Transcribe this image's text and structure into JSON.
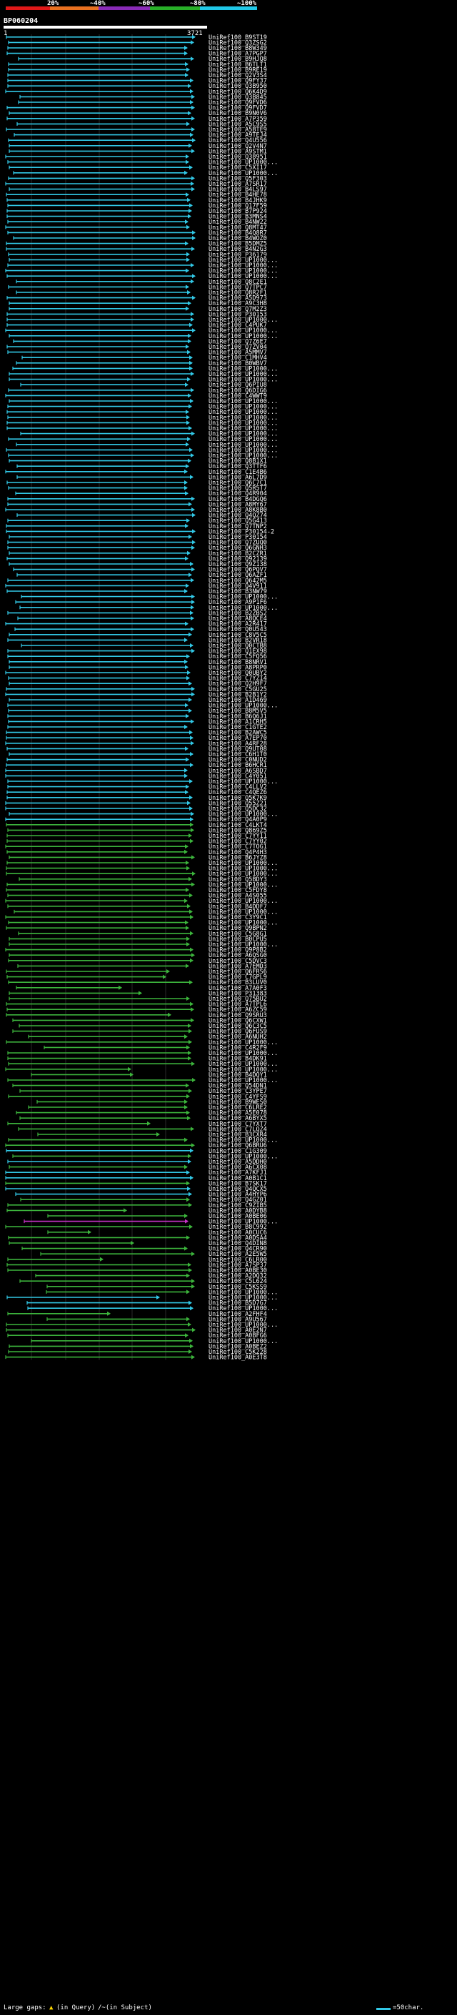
{
  "scale": {
    "labels": [
      "20%",
      "~40%",
      "~60%",
      "~80%",
      "~100%"
    ],
    "colors": [
      "#e01818",
      "#e87020",
      "#8a2bb8",
      "#28b028",
      "#20c8e8"
    ]
  },
  "query": {
    "name": "BP060204",
    "start": "1",
    "end": "3721"
  },
  "footer": {
    "gaps_label": "Large gaps:",
    "gap_query": "(in Query)",
    "gap_subject": "/~(in Subject)",
    "legend": "=50char."
  },
  "colors": {
    "cyan": "#32c8e6",
    "green": "#3cb43c",
    "magenta": "#c832c8",
    "grid": "#c8c8c8",
    "background": "#000000"
  },
  "hits": [
    "UniRef100_B9ST19",
    "UniRef100_Q3ZSG2",
    "UniRef100_B8W349",
    "UniRef100_A7PGP7",
    "UniRef100_B9HJQ8",
    "UniRef100_B6TLT1",
    "UniRef100_B9RE19",
    "UniRef100_Q2V3S4",
    "UniRef100_Q9FY37",
    "UniRef100_Q3B950",
    "UniRef100_Q6K4D9",
    "UniRef100_Q3B845",
    "UniRef100_Q9FVD6",
    "UniRef100_Q9FVD7",
    "UniRef100_B9N0V6",
    "UniRef100_A7P359",
    "UniRef100_A5C9S5",
    "UniRef100_A5BTE9",
    "UniRef100_A9TEJ4",
    "UniRef100_Q4U556",
    "UniRef100_Q2V4N7",
    "UniRef100_A9STM1",
    "UniRef100_Q38951",
    "UniRef100_UP1000...",
    "UniRef100_C5XI17",
    "UniRef100_UP1000...",
    "UniRef100_Q5F303",
    "UniRef100_A7SR17",
    "UniRef100_B4LS97",
    "UniRef100_B4HE78",
    "UniRef100_B4JHK9",
    "UniRef100_Q17F59",
    "UniRef100_B7P924",
    "UniRef100_B3MNS4",
    "UniRef100_B4NW22",
    "UniRef100_Q8MT47",
    "UniRef100_B4Q8R7",
    "UniRef100_B4WOZ0",
    "UniRef100_B5DMZ5",
    "UniRef100_B4N2G3",
    "UniRef100_P36179",
    "UniRef100_UP1000...",
    "UniRef100_UP1000...",
    "UniRef100_UP1000...",
    "UniRef100_UP1000...",
    "UniRef100_Q8C2E1",
    "UniRef100_Q7TPC7",
    "UniRef100_Q8R2F1",
    "UniRef100_A5D973",
    "UniRef100_A9C3H8",
    "UniRef100_Q7M2Z3",
    "UniRef100_P30153",
    "UniRef100_UP1000...",
    "UniRef100_C4PUK7",
    "UniRef100_UP1000...",
    "UniRef100_UP1000...",
    "UniRef100_Q7Z6E7",
    "UniRef100_Q7ZV04",
    "UniRef100_A5MMV7",
    "UniRef100_C1MHV4",
    "UniRef100_B0WBV7",
    "UniRef100_UP1000...",
    "UniRef100_UP1000...",
    "UniRef100_UP1000...",
    "UniRef100_Q6PIU8",
    "UniRef100_Q6DIG6",
    "UniRef100_C4WWT9",
    "UniRef100_UP1000...",
    "UniRef100_UP1000...",
    "UniRef100_UP1000...",
    "UniRef100_UP1000...",
    "UniRef100_UP1000...",
    "UniRef100_UP1000...",
    "UniRef100_UP1000...",
    "UniRef100_UP1000...",
    "UniRef100_UP1000...",
    "UniRef100_UP1000...",
    "UniRef100_UP1000...",
    "UniRef100_Q8B1X1",
    "UniRef100_Q3TTF6",
    "UniRef100_C1E4B6",
    "UniRef100_A6L7D9",
    "UniRef100_Q6C7C1",
    "UniRef100_Q5R5T7",
    "UniRef100_Q4R904",
    "UniRef100_B4DGQ6",
    "UniRef100_A8MY67",
    "UniRef100_A8K8B0",
    "UniRef100_Q4QZ74",
    "UniRef100_Q5G413",
    "UniRef100_Q7TNP2",
    "UniRef100_P30154-2",
    "UniRef100_P30154",
    "UniRef100_Q7ZUQ0",
    "UniRef100_Q6GNH3",
    "UniRef100_B2CZR1",
    "UniRef100_Q92139",
    "UniRef100_Q9Z138",
    "UniRef100_Q6PQV7",
    "UniRef100_Q6AZF1",
    "UniRef100_Q642M5",
    "UniRef100_Q4V911",
    "UniRef100_B3NW79",
    "UniRef100_UP1000...",
    "UniRef100_A9P1F6",
    "UniRef100_UP1000...",
    "UniRef100_B2ZBS2",
    "UniRef100_A8QCE4",
    "UniRef100_A2R417",
    "UniRef100_Q0U543",
    "UniRef100_C8V5C5",
    "UniRef100_B2VR18",
    "UniRef100_Q0CTB8",
    "UniRef100_Q1EX98",
    "UniRef100_C5FQ56",
    "UniRef100_B8NRV1",
    "UniRef100_A8PRP0",
    "UniRef100_Q0UBY2",
    "UniRef100_C7YZI4",
    "UniRef100_Q2H9F7",
    "UniRef100_C5GU25",
    "UniRef100_B2B1Y2",
    "UniRef100_A1D469",
    "UniRef100_UP1000...",
    "UniRef100_B8M5V5",
    "UniRef100_B6Q6J1",
    "UniRef100_A1CRH5",
    "UniRef100_C1GTE2",
    "UniRef100_B2AWC5",
    "UniRef100_A7EP70",
    "UniRef100_A4RF28",
    "UniRef100_Q9UT08",
    "UniRef100_C6H1T0",
    "UniRef100_C0NUD2",
    "UniRef100_B6HCR1",
    "UniRef100_A6SBD7",
    "UniRef100_C4Y051",
    "UniRef100_UP1000...",
    "UniRef100_C4LLV2",
    "UniRef100_C4QEZ6",
    "UniRef100_Q5K7K9",
    "UniRef100_Q55Z21",
    "UniRef100_Q5DC32",
    "UniRef100_UP1000...",
    "UniRef100_Q4A0P9",
    "UniRef100_C4LKT4",
    "UniRef100_Q869Z5",
    "UniRef100_C7YY11",
    "UniRef100_C7YY02",
    "UniRef100_C7TOG1",
    "UniRef100_Q4P4H3",
    "UniRef100_B6JYZ8",
    "UniRef100_UP1000...",
    "UniRef100_UP1000...",
    "UniRef100_UP1000...",
    "UniRef100_Q5BDY3",
    "UniRef100_UP1000...",
    "UniRef100_C5FDY8",
    "UniRef100_A4S055",
    "UniRef100_UP1000...",
    "UniRef100_B4DDF7",
    "UniRef100_UP1000...",
    "UniRef100_C3Y9C1",
    "UniRef100_UP1000...",
    "UniRef100_Q9BPN2",
    "UniRef100_C5G8G1",
    "UniRef100_B0CPU5",
    "UniRef100_UP1000...",
    "UniRef100_Q9P8B2",
    "UniRef100_A6QSG0",
    "UniRef100_C5DVC3",
    "UniRef100_A7EMD3",
    "UniRef100_Q6FRS6",
    "UniRef100_C7GPL9",
    "UniRef100_B3LUV0",
    "UniRef100_A7A0F3",
    "UniRef100_P31383",
    "UniRef100_Q75BU2",
    "UniRef100_A7TPL6",
    "UniRef100_A6ZC59",
    "UniRef100_Q9SRU3",
    "UniRef100_Q6CXW1",
    "UniRef100_Q6C3C5",
    "UniRef100_Q6FUS9",
    "UniRef100_A6NUH2",
    "UniRef100_UP1000...",
    "UniRef100_C4R2F9",
    "UniRef100_UP1000...",
    "UniRef100_B4DK91",
    "UniRef100_UP1000...",
    "UniRef100_UP1000...",
    "UniRef100_B4DQY1",
    "UniRef100_UP1000...",
    "UniRef100_Q54DN1",
    "UniRef100_C3YPE7",
    "UniRef100_C4YFS9",
    "UniRef100_B9WES0",
    "UniRef100_C6LRE2",
    "UniRef100_A5E078",
    "UniRef100_A6BYX5",
    "UniRef100_C7YXT7",
    "UniRef100_C7LQZ4",
    "UniRef100_B3CXR4",
    "UniRef100_UP1000...",
    "UniRef100_Q6BRU6",
    "UniRef100_C1G309",
    "UniRef100_UP1000...",
    "UniRef100_A5DDH0",
    "UniRef100_A6CX08",
    "UniRef100_A7KFJ1",
    "UniRef100_A0B1C1",
    "UniRef100_B7SK17",
    "UniRef100_Q4QCX5",
    "UniRef100_A4HYP6",
    "UniRef100_Q4GZ01",
    "UniRef100_C9ZIB5",
    "UniRef100_A0DYB8",
    "UniRef100_A0BE06",
    "UniRef100_UP1000...",
    "UniRef100_B8C992",
    "UniRef100_A0CUC6",
    "UniRef100_A0DSA4",
    "UniRef100_Q4DIN8",
    "UniRef100_Q4CR90",
    "UniRef100_A2E5W5",
    "UniRef100_C6LR00",
    "UniRef100_A7SP37",
    "UniRef100_A0BE30",
    "UniRef100_A2DQ32",
    "UniRef100_C5L624",
    "UniRef100_C5KSS9",
    "UniRef100_UP1000...",
    "UniRef100_UP1000...",
    "UniRef100_B5D7G7",
    "UniRef100_UP1000...",
    "UniRef100_A2FHF4",
    "UniRef100_A9U567",
    "UniRef100_UP1000...",
    "UniRef100_A0E2N7",
    "UniRef100_A0BFG6",
    "UniRef100_UP1000...",
    "UniRef100_A0BEZ2",
    "UniRef100_C5K228",
    "UniRef100_A0E3T8"
  ]
}
